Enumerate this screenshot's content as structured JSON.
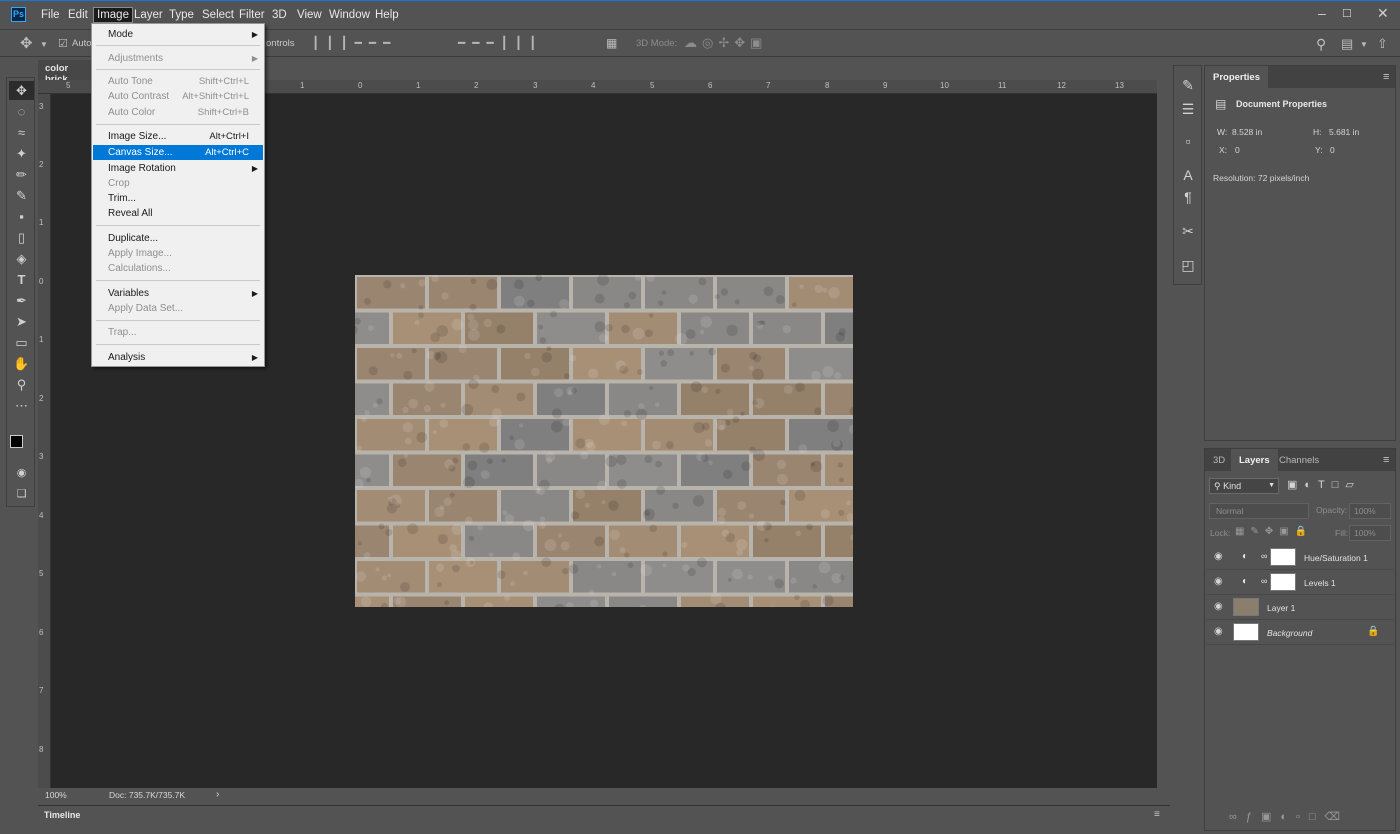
{
  "app": {
    "logo": "Ps"
  },
  "menubar": {
    "items": [
      "File",
      "Edit",
      "Image",
      "Layer",
      "Type",
      "Select",
      "Filter",
      "3D",
      "View",
      "Window",
      "Help"
    ],
    "active": "Image"
  },
  "options": {
    "auto_select_label": "Auto-",
    "transform_controls_label": "ontrols",
    "mode_3d_label": "3D Mode:"
  },
  "document": {
    "tab_title": "color brick.",
    "zoom": "100%",
    "doc_size": "Doc: 735.7K/735.7K",
    "ruler_top_labels": [
      "5",
      "4",
      "3",
      "2",
      "1",
      "0",
      "1",
      "2",
      "3",
      "4",
      "5",
      "6",
      "7",
      "8",
      "9",
      "10",
      "11",
      "12",
      "13"
    ],
    "ruler_left_labels": [
      "3",
      "2",
      "1",
      "0",
      "1",
      "2",
      "3",
      "4",
      "5",
      "6",
      "7",
      "8"
    ]
  },
  "image_menu": {
    "items": [
      {
        "label": "Mode",
        "shortcut": "",
        "submenu": true,
        "disabled": false
      },
      {
        "label": "Adjustments",
        "shortcut": "",
        "submenu": true,
        "disabled": true
      },
      {
        "label": "Auto Tone",
        "shortcut": "Shift+Ctrl+L",
        "disabled": true
      },
      {
        "label": "Auto Contrast",
        "shortcut": "Alt+Shift+Ctrl+L",
        "disabled": true
      },
      {
        "label": "Auto Color",
        "shortcut": "Shift+Ctrl+B",
        "disabled": true
      },
      {
        "label": "Image Size...",
        "shortcut": "Alt+Ctrl+I",
        "disabled": false
      },
      {
        "label": "Canvas Size...",
        "shortcut": "Alt+Ctrl+C",
        "disabled": false,
        "highlighted": true
      },
      {
        "label": "Image Rotation",
        "shortcut": "",
        "submenu": true,
        "disabled": false
      },
      {
        "label": "Crop",
        "shortcut": "",
        "disabled": true
      },
      {
        "label": "Trim...",
        "shortcut": "",
        "disabled": false
      },
      {
        "label": "Reveal All",
        "shortcut": "",
        "disabled": false
      },
      {
        "label": "Duplicate...",
        "shortcut": "",
        "disabled": false
      },
      {
        "label": "Apply Image...",
        "shortcut": "",
        "disabled": true
      },
      {
        "label": "Calculations...",
        "shortcut": "",
        "disabled": true
      },
      {
        "label": "Variables",
        "shortcut": "",
        "submenu": true,
        "disabled": false
      },
      {
        "label": "Apply Data Set...",
        "shortcut": "",
        "disabled": true
      },
      {
        "label": "Trap...",
        "shortcut": "",
        "disabled": true
      },
      {
        "label": "Analysis",
        "shortcut": "",
        "submenu": true,
        "disabled": false
      }
    ]
  },
  "properties": {
    "tab": "Properties",
    "section_title": "Document Properties",
    "w_label": "W:",
    "w_value": "8.528 in",
    "h_label": "H:",
    "h_value": "5.681 in",
    "x_label": "X:",
    "x_value": "0",
    "y_label": "Y:",
    "y_value": "0",
    "resolution": "Resolution: 72 pixels/inch"
  },
  "layers_panel": {
    "tabs": [
      "3D",
      "Layers",
      "Channels"
    ],
    "active_tab": "Layers",
    "kind_filter": "Kind",
    "blend_mode": "Normal",
    "opacity_label": "Opacity:",
    "opacity_value": "100%",
    "lock_label": "Lock:",
    "fill_label": "Fill:",
    "fill_value": "100%",
    "layers": [
      {
        "name": "Hue/Saturation 1",
        "type": "adjustment"
      },
      {
        "name": "Levels 1",
        "type": "adjustment"
      },
      {
        "name": "Layer 1",
        "type": "image"
      },
      {
        "name": "Background",
        "type": "background",
        "locked": true
      }
    ]
  },
  "timeline": {
    "label": "Timeline"
  },
  "colors": {
    "accent": "#0078d7",
    "canvas_bg": "#282828",
    "panel_bg": "#535353",
    "menu_bg": "#f0f0f0"
  }
}
